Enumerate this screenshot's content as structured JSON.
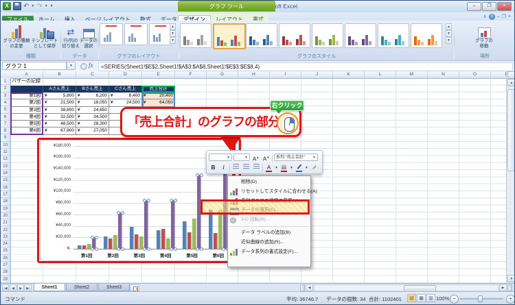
{
  "window": {
    "title": "バザーの記録 - Microsoft Excel",
    "contextual_title": "グラフ ツール"
  },
  "tabs": {
    "file": "ファイル",
    "main": [
      "ホーム",
      "挿入",
      "ページ レイアウト",
      "数式",
      "データ",
      "校閲",
      "表示"
    ],
    "contextual": [
      "デザイン",
      "レイアウト",
      "書式"
    ],
    "active": "デザイン"
  },
  "ribbon": {
    "groups": {
      "type": {
        "label": "種類",
        "buttons": [
          "グラフの種類\nの変更",
          "テンプレート\nとして保存"
        ]
      },
      "data": {
        "label": "データ",
        "buttons": [
          "行/列の\n切り替え",
          "データの\n選択"
        ]
      },
      "layouts": {
        "label": "グラフのレイアウト"
      },
      "styles": {
        "label": "グラフのスタイル",
        "selected_index": 1,
        "palettes": [
          [
            "#7f7f7f",
            "#a6a6a6",
            "#d9d9d9"
          ],
          [
            "#4f81bd",
            "#c0504d",
            "#9bbb59"
          ],
          [
            "#2e5c8a",
            "#4f81bd",
            "#95b3d7"
          ],
          [
            "#943634",
            "#c0504d",
            "#d99694"
          ],
          [
            "#76923c",
            "#9bbb59",
            "#c3d69b"
          ],
          [
            "#5f497a",
            "#8064a2",
            "#b2a2c7"
          ],
          [
            "#31859c",
            "#4bacc6",
            "#92cddc"
          ],
          [
            "#e36c0a",
            "#f79646",
            "#fac090"
          ]
        ]
      },
      "location": {
        "label": "場所",
        "buttons": [
          "グラフの\n移動"
        ]
      }
    }
  },
  "formula_bar": {
    "name_box": "グラフ 1",
    "fx": "fx",
    "formula": "=SERIES(Sheet1!$E$2,Sheet1!$A$3:$A$8,Sheet1!$E$3:$E$8,4)"
  },
  "sheet": {
    "col_letters": [
      "A",
      "B",
      "C",
      "D",
      "E",
      "F",
      "G",
      "H",
      "I",
      "J",
      "K",
      "L",
      "M",
      "N",
      "O",
      "P"
    ],
    "row_count": 29,
    "table": {
      "title": "バザーの記録",
      "currency": "¥",
      "headers": [
        "Aさん売上",
        "Bさん売上",
        "Cさん売上",
        "売上合計"
      ],
      "rows": [
        {
          "label": "第1回",
          "a": "5,800",
          "b": "6,200",
          "c": "8,400",
          "total": "20,400"
        },
        {
          "label": "第2回",
          "a": "21,500",
          "b": "18,050",
          "c": "24,500",
          "total": "64,050"
        },
        {
          "label": "第3回",
          "a": "38,800",
          "b": "24,650",
          "c": "",
          "total": ""
        },
        {
          "label": "第4回",
          "a": "32,500",
          "b": "34,500",
          "c": "",
          "total": ""
        },
        {
          "label": "第5回",
          "a": "48,500",
          "b": "28,300",
          "c": "",
          "total": ""
        },
        {
          "label": "第6回",
          "a": "67,900",
          "b": "27,050",
          "c": "",
          "total": ""
        }
      ]
    }
  },
  "chart_data": {
    "type": "bar",
    "categories": [
      "第1回",
      "第2回",
      "第3回",
      "第4回",
      "第5回",
      "第6回"
    ],
    "series": [
      {
        "name": "Aさん売上",
        "color": "#4f81bd",
        "values": [
          5800,
          21500,
          38800,
          32500,
          48500,
          67900
        ]
      },
      {
        "name": "Bさん売上",
        "color": "#c0504d",
        "values": [
          6200,
          18050,
          24650,
          34500,
          28300,
          27050
        ]
      },
      {
        "name": "Cさん売上",
        "color": "#9bbb59",
        "values": [
          8400,
          24500,
          21500,
          18500,
          52500,
          69000
        ]
      },
      {
        "name": "売上合計",
        "color": "#8064a2",
        "values": [
          20400,
          64050,
          85000,
          85500,
          129300,
          163950
        ],
        "selected": true
      }
    ],
    "ylim": [
      0,
      180000
    ],
    "y_tick_labels": [
      "¥180,000",
      "¥160,000",
      "¥140,000",
      "¥120,000",
      "¥100,000",
      "¥80,000",
      "¥60,000",
      "¥40,000",
      "¥20,000",
      "¥-"
    ],
    "legend": "none",
    "grid": true
  },
  "annotation": {
    "callout_text": "「売上合計」のグラフの部分",
    "badge": "右クリック",
    "accent_red": "#e21313",
    "badge_green": "#2e9e3e"
  },
  "mini_toolbar": {
    "bold": "B",
    "italic": "I",
    "font_color": "A",
    "series_label": "系列 \"売上合計\""
  },
  "context_menu": {
    "items": [
      {
        "label": "削除(D)"
      },
      {
        "label": "リセットしてスタイルに合わせる(A)",
        "icon": "reset-style-icon"
      },
      {
        "label": "系列グラフの種類の変更(Y)...",
        "icon": "change-series-chart-type-icon",
        "highlighted": true
      },
      {
        "label": "データの選択(E)...",
        "icon": "select-data-icon"
      },
      {
        "label": "3-D 回転(R)...",
        "icon": "rotation-3d-icon",
        "disabled": true
      },
      {
        "separator": true
      },
      {
        "label": "データ ラベルの追加(B)"
      },
      {
        "label": "近似曲線の追加(R)..."
      },
      {
        "label": "データ系列の書式設定(F)...",
        "icon": "format-data-series-icon"
      }
    ]
  },
  "sheet_tabs": {
    "tabs": [
      "Sheet1",
      "Sheet2",
      "Sheet3"
    ],
    "active": "Sheet1"
  },
  "status_bar": {
    "mode": "コマンド",
    "average": "平均: 36746.7",
    "count": "データの個数: 34",
    "sum": "合計: 1102401",
    "zoom": "100%"
  }
}
